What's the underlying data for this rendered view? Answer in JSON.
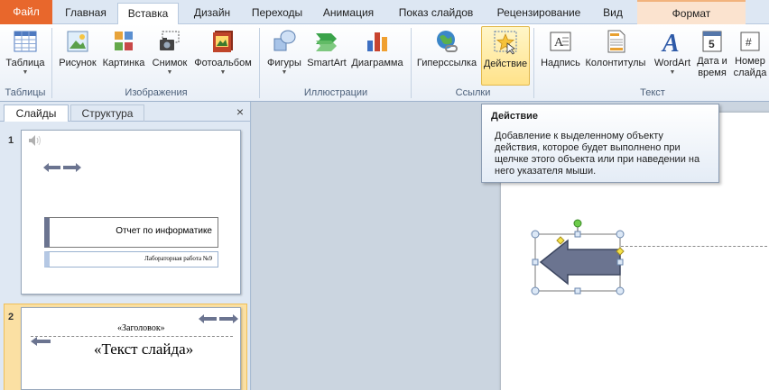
{
  "tabs": {
    "file": "Файл",
    "home": "Главная",
    "insert": "Вставка",
    "design": "Дизайн",
    "transitions": "Переходы",
    "animation": "Анимация",
    "slideshow": "Показ слайдов",
    "review": "Рецензирование",
    "view": "Вид",
    "format": "Формат"
  },
  "ribbon": {
    "table": "Таблица",
    "picture": "Рисунок",
    "clipart": "Картинка",
    "screenshot": "Снимок",
    "photoalbum": "Фотоальбом",
    "shapes": "Фигуры",
    "smartart": "SmartArt",
    "chart": "Диаграмма",
    "hyperlink": "Гиперссылка",
    "action": "Действие",
    "textbox": "Надпись",
    "headerfooter": "Колонтитулы",
    "wordart": "WordArt",
    "datetime_1": "Дата и",
    "datetime_2": "время",
    "slidenum_1": "Номер",
    "slidenum_2": "слайда",
    "groups": {
      "tables": "Таблицы",
      "images": "Изображения",
      "illustrations": "Иллюстрации",
      "links": "Ссылки",
      "text": "Текст"
    }
  },
  "pane": {
    "tab_slides": "Слайды",
    "tab_outline": "Структура",
    "close": "×"
  },
  "slides": [
    {
      "number": "1",
      "title": "Отчет по информатике",
      "subtitle": "Лабораторная работа №9"
    },
    {
      "number": "2",
      "heading": "«Заголовок»",
      "body": "«Текст слайда»"
    }
  ],
  "tooltip": {
    "title": "Действие",
    "body": "Добавление к выделенному объекту действия, которое будет выполнено при щелчке этого объекта или при наведении на него указателя мыши."
  },
  "colors": {
    "file_tab": "#e8672c",
    "arrow_fill": "#6b7490",
    "highlight": "#ffe28a"
  }
}
